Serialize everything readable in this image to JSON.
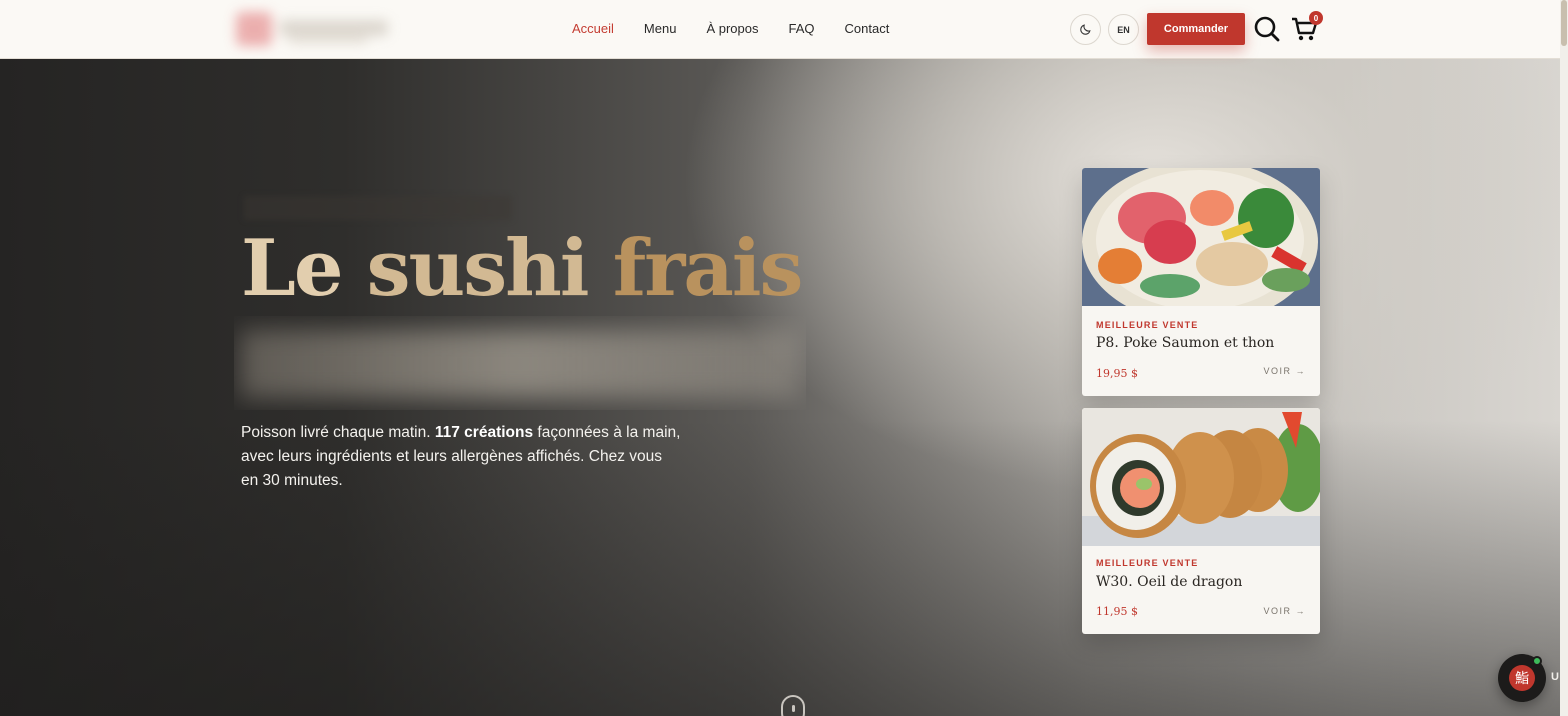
{
  "header": {
    "nav": [
      {
        "label": "Accueil",
        "active": true
      },
      {
        "label": "Menu"
      },
      {
        "label": "À propos"
      },
      {
        "label": "FAQ"
      },
      {
        "label": "Contact"
      }
    ],
    "lang_label": "EN",
    "order_label": "Commander",
    "cart_count": "0",
    "icons": [
      "moon-icon",
      "search-icon",
      "cart-icon"
    ]
  },
  "hero": {
    "title_word_1": "Le",
    "title_word_2": "sushi",
    "title_word_3": "frais",
    "text_before": "Poisson livré chaque matin. ",
    "text_bold": "117 créations",
    "text_after": " façonnées à la main, avec leurs ingrédients et leurs allergènes affichés. Chez vous en 30 minutes."
  },
  "cards": [
    {
      "tag": "MEILLEURE VENTE",
      "name": "P8. Poke Saumon et thon",
      "price": "19,95 $",
      "view": "VOIR →"
    },
    {
      "tag": "MEILLEURE VENTE",
      "name": "W30. Oeil de dragon",
      "price": "11,95 $",
      "view": "VOIR →"
    }
  ],
  "chat": {
    "glyph": "鮨",
    "peek": "U"
  },
  "colors": {
    "accent": "#c0372d",
    "gold": "#b9925e",
    "cream": "#fbf9f5"
  }
}
